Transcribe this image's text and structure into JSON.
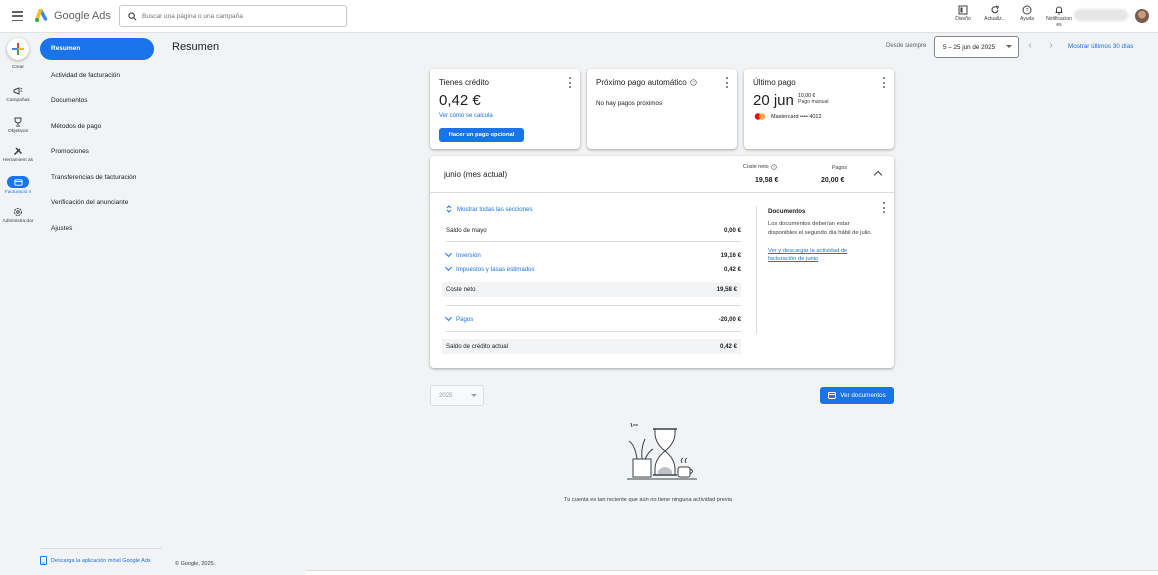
{
  "app": {
    "name": "Google Ads",
    "search_placeholder": "Buscar una página o una campaña"
  },
  "topbar": {
    "icons": [
      {
        "icon": "design-icon",
        "label": "Diseño"
      },
      {
        "icon": "refresh-icon",
        "label": "Actualiz..."
      },
      {
        "icon": "help-icon",
        "label": "Ayuda"
      },
      {
        "icon": "bell-icon",
        "label": "Notificacion es"
      }
    ]
  },
  "rail": {
    "create": "Crear",
    "items": [
      {
        "icon": "campaigns-icon",
        "label": "Campañas"
      },
      {
        "icon": "goals-icon",
        "label": "Objetivos"
      },
      {
        "icon": "tools-icon",
        "label": "Herramient as"
      },
      {
        "icon": "billing-icon",
        "label": "Facturació n"
      },
      {
        "icon": "admin-icon",
        "label": "Administra dor"
      }
    ]
  },
  "subnav": {
    "items": [
      "Resumen",
      "Actividad de facturación",
      "Documentos",
      "Métodos de pago",
      "Promociones",
      "Transferencias de facturación",
      "Verificación del anunciante",
      "Ajustes"
    ],
    "footer": "Descarga la aplicación móvil Google Ads",
    "copyright": "© Google, 2025."
  },
  "header": {
    "title": "Resumen",
    "since_label": "Desde siempre",
    "date_range": "5 – 25 jun de 2025",
    "last30": "Mostrar últimos 30 días"
  },
  "credit_card": {
    "title": "Tienes crédito",
    "amount": "0,42 €",
    "link": "Ver cómo se calcula",
    "button": "Hacer un pago opcional"
  },
  "next_payment_card": {
    "title": "Próximo pago automático",
    "text": "No hay pagos próximos"
  },
  "last_payment_card": {
    "title": "Último pago",
    "date": "20 jun",
    "amount": "10,00 €",
    "method_type": "Pago manual",
    "card": "Mastercard •••• 4012"
  },
  "month": {
    "title": "junio (mes actual)",
    "net_cost_label": "Coste neto",
    "net_cost": "19,58 €",
    "payments_label": "Pagos",
    "payments": "20,00 €",
    "show_all": "Mostrar todas las secciones",
    "rows": {
      "may_balance": {
        "label": "Saldo de mayo",
        "value": "0,00 €"
      },
      "investment": {
        "label": "Inversión",
        "value": "19,16 €"
      },
      "taxes": {
        "label": "Impuestos y tasas estimados",
        "value": "0,42 €"
      },
      "net_cost": {
        "label": "Coste neto",
        "value": "19,58 €"
      },
      "payments": {
        "label": "Pagos",
        "value": "-20,00 €"
      },
      "current_credit": {
        "label": "Saldo de crédito actual",
        "value": "0,42 €"
      }
    },
    "documents": {
      "title": "Documentos",
      "text": "Los documentos deberían estar disponibles el segundo día hábil de julio.",
      "link": "Ver y descargar la actividad de facturación de junio"
    }
  },
  "history": {
    "year": "2025",
    "view_docs": "Ver documentos",
    "empty": "Tu cuenta es tan reciente que aún no tiene ninguna actividad previa"
  },
  "colors": {
    "accent": "#1a73e8",
    "background": "#f1f3f4"
  }
}
